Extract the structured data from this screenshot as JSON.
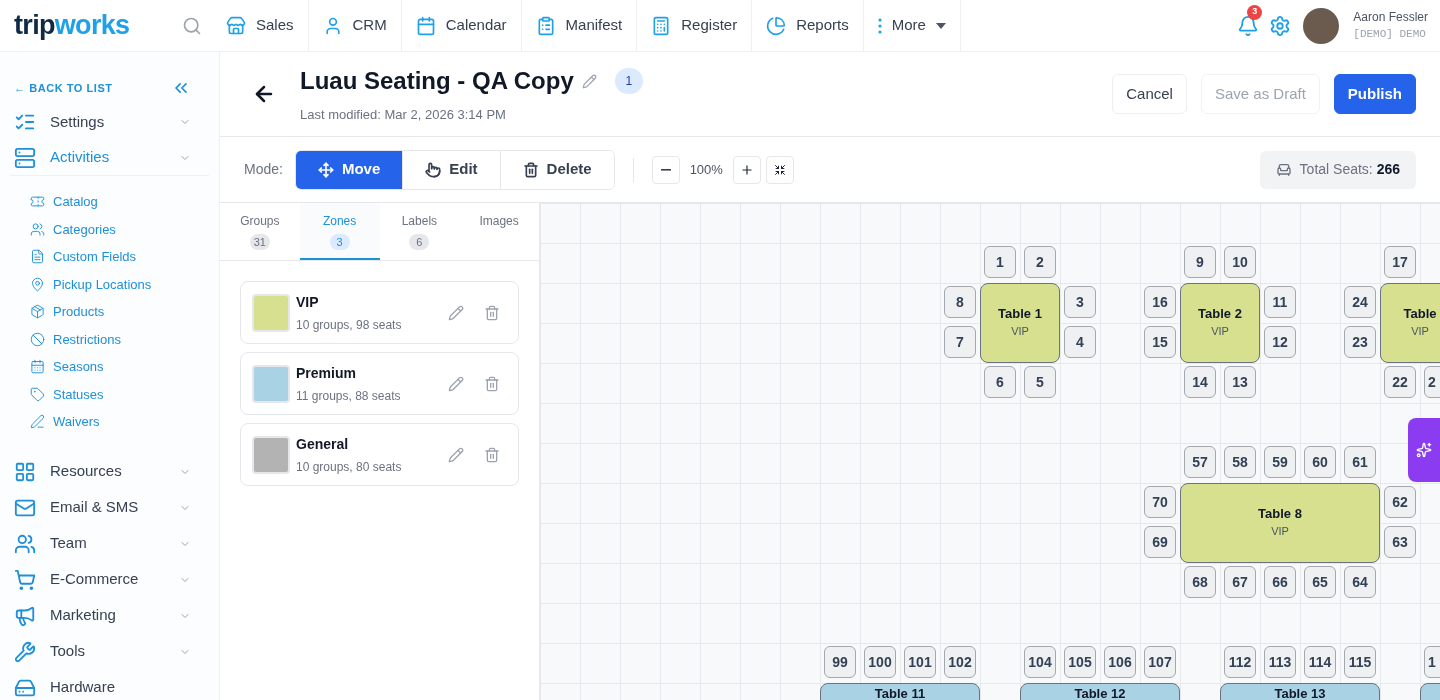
{
  "nav": {
    "logo_left": "trip",
    "logo_right": "works",
    "items": [
      {
        "label": "Sales"
      },
      {
        "label": "CRM"
      },
      {
        "label": "Calendar"
      },
      {
        "label": "Manifest"
      },
      {
        "label": "Register"
      },
      {
        "label": "Reports"
      },
      {
        "label": "More"
      }
    ],
    "notifications": "3",
    "user": {
      "name": "Aaron Fessler",
      "account": "[DEMO] DEMO"
    }
  },
  "sidebar": {
    "back": "← BACK TO LIST",
    "items": [
      {
        "label": "Settings",
        "kind": "group",
        "expanded": false
      },
      {
        "label": "Activities",
        "kind": "group",
        "expanded": true,
        "children": [
          {
            "label": "Catalog"
          },
          {
            "label": "Categories"
          },
          {
            "label": "Custom Fields"
          },
          {
            "label": "Pickup Locations"
          },
          {
            "label": "Products"
          },
          {
            "label": "Restrictions"
          },
          {
            "label": "Seasons"
          },
          {
            "label": "Statuses"
          },
          {
            "label": "Waivers"
          }
        ]
      },
      {
        "label": "Resources",
        "kind": "group",
        "expanded": false
      },
      {
        "label": "Email & SMS",
        "kind": "group",
        "expanded": false
      },
      {
        "label": "Team",
        "kind": "group",
        "expanded": false
      },
      {
        "label": "E-Commerce",
        "kind": "group",
        "expanded": false
      },
      {
        "label": "Marketing",
        "kind": "group",
        "expanded": false
      },
      {
        "label": "Tools",
        "kind": "group",
        "expanded": false
      },
      {
        "label": "Hardware",
        "kind": "link",
        "expanded": false
      }
    ]
  },
  "header": {
    "title": "Luau Seating - QA Copy",
    "version": "1",
    "modified": "Last modified: Mar 2, 2026 3:14 PM",
    "buttons": [
      {
        "label": "Cancel",
        "kind": "secondary"
      },
      {
        "label": "Save as Draft",
        "kind": "disabled"
      },
      {
        "label": "Publish",
        "kind": "primary"
      }
    ]
  },
  "toolbar": {
    "mode_label": "Mode:",
    "modes": [
      {
        "label": "Move",
        "selected": true
      },
      {
        "label": "Edit",
        "selected": false
      },
      {
        "label": "Delete",
        "selected": false
      }
    ],
    "zoom": "100%",
    "total_label": "Total Seats:",
    "total": "266"
  },
  "tabs": [
    {
      "label": "Groups",
      "count": "31",
      "selected": false
    },
    {
      "label": "Zones",
      "count": "3",
      "selected": true
    },
    {
      "label": "Labels",
      "count": "6",
      "selected": false
    },
    {
      "label": "Images",
      "selected": false
    }
  ],
  "zones": [
    {
      "name": "VIP",
      "summary": "10 groups, 98 seats",
      "color": "#d6e08f"
    },
    {
      "name": "Premium",
      "summary": "11 groups, 88 seats",
      "color": "#a9d3e5"
    },
    {
      "name": "General",
      "summary": "10 groups, 80 seats",
      "color": "#b3b3b3"
    }
  ],
  "canvas": {
    "seats": [
      "1",
      "2",
      "8",
      "7",
      "3",
      "4",
      "6",
      "5",
      "9",
      "10",
      "16",
      "15",
      "11",
      "12",
      "14",
      "13",
      "17",
      "24",
      "23",
      "22",
      "2",
      "57",
      "58",
      "59",
      "60",
      "61",
      "70",
      "69",
      "62",
      "63",
      "68",
      "67",
      "66",
      "65",
      "64",
      "99",
      "100",
      "101",
      "102",
      "104",
      "105",
      "106",
      "107",
      "112",
      "113",
      "114",
      "115",
      "1"
    ],
    "tables": [
      {
        "label": "Table 1",
        "zone": "VIP",
        "color": "#d6e08f"
      },
      {
        "label": "Table 2",
        "zone": "VIP",
        "color": "#d6e08f"
      },
      {
        "label": "Table",
        "zone": "VIP",
        "color": "#d6e08f"
      },
      {
        "label": "Table 8",
        "zone": "VIP",
        "color": "#d6e08f"
      },
      {
        "label": "Table 11",
        "color": "#a9d3e5"
      },
      {
        "label": "Table 12",
        "color": "#a9d3e5"
      },
      {
        "label": "Table 13",
        "color": "#a9d3e5"
      },
      {
        "color": "#a9d3e5"
      }
    ]
  }
}
